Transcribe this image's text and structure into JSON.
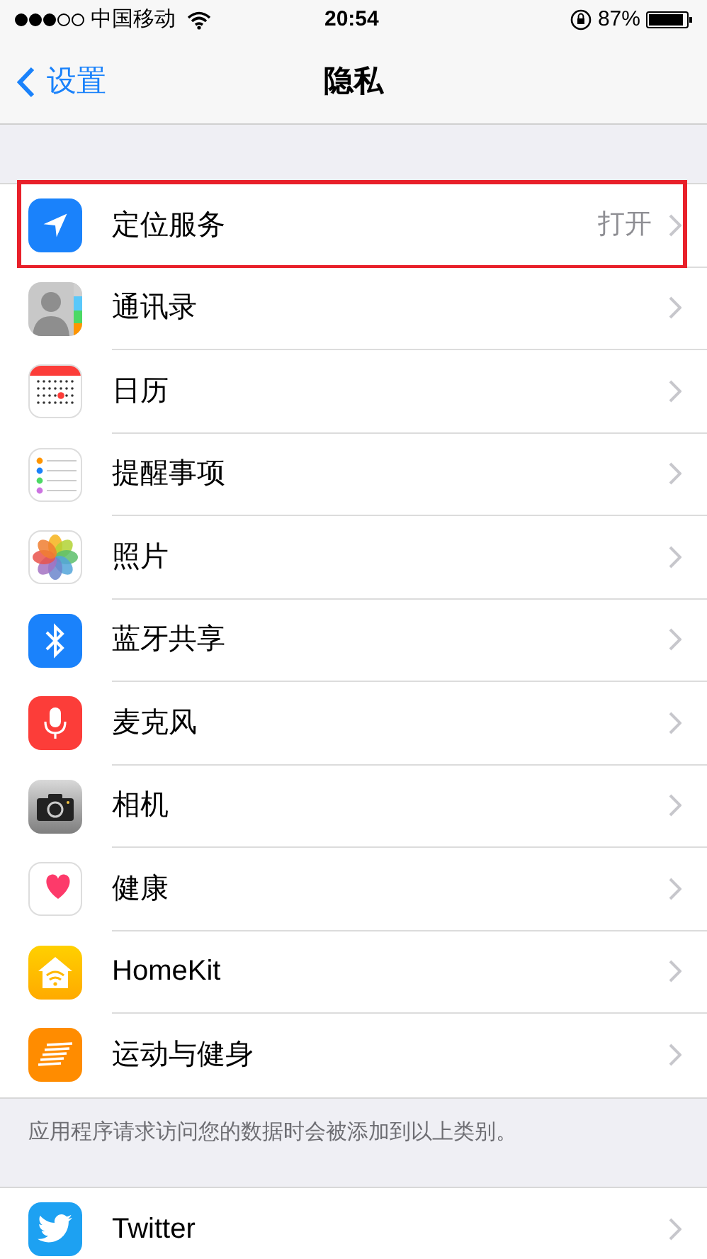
{
  "status_bar": {
    "carrier": "中国移动",
    "time": "20:54",
    "battery": "87%"
  },
  "nav": {
    "back": "设置",
    "title": "隐私"
  },
  "items": [
    {
      "kind": "location",
      "label": "定位服务",
      "value": "打开",
      "highlighted": true
    },
    {
      "kind": "contacts",
      "label": "通讯录",
      "highlighted": false
    },
    {
      "kind": "calendar",
      "label": "日历",
      "highlighted": false
    },
    {
      "kind": "reminders",
      "label": "提醒事项",
      "highlighted": false
    },
    {
      "kind": "photos",
      "label": "照片",
      "highlighted": false
    },
    {
      "kind": "bluetooth",
      "label": "蓝牙共享",
      "highlighted": false
    },
    {
      "kind": "microphone",
      "label": "麦克风",
      "highlighted": false
    },
    {
      "kind": "camera",
      "label": "相机",
      "highlighted": false
    },
    {
      "kind": "health",
      "label": "健康",
      "highlighted": false
    },
    {
      "kind": "homekit",
      "label": "HomeKit",
      "highlighted": false
    },
    {
      "kind": "motion",
      "label": "运动与健身",
      "highlighted": false
    }
  ],
  "footer": "应用程序请求访问您的数据时会被添加到以上类别。",
  "items2": [
    {
      "kind": "twitter",
      "label": "Twitter",
      "highlighted": false
    }
  ]
}
